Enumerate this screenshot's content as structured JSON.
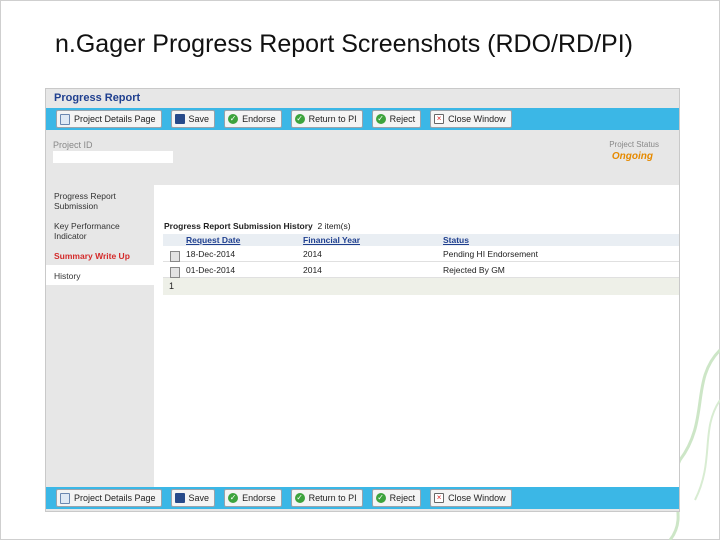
{
  "slide": {
    "title": "n.Gager Progress Report Screenshots (RDO/RD/PI)"
  },
  "app": {
    "header_title": "Progress Report"
  },
  "toolbar": [
    {
      "label": "Project Details Page",
      "icon": "page-icon"
    },
    {
      "label": "Save",
      "icon": "disk-icon"
    },
    {
      "label": "Endorse",
      "icon": "check-icon"
    },
    {
      "label": "Return to PI",
      "icon": "check-icon"
    },
    {
      "label": "Reject",
      "icon": "check-icon"
    },
    {
      "label": "Close Window",
      "icon": "close-icon"
    }
  ],
  "project": {
    "id_label": "Project ID",
    "id_value": "",
    "status_label": "Project Status",
    "status_value": "Ongoing"
  },
  "sidebar": {
    "items": [
      {
        "label": "Progress Report Submission"
      },
      {
        "label": "Key Performance Indicator"
      },
      {
        "label": "Summary Write Up"
      },
      {
        "label": "History"
      }
    ]
  },
  "history": {
    "title": "Progress Report Submission History",
    "count": "2 item(s)",
    "headers": [
      "Request Date",
      "Financial Year",
      "Status"
    ],
    "rows": [
      [
        "18-Dec-2014",
        "2014",
        "Pending HI Endorsement"
      ],
      [
        "01-Dec-2014",
        "2014",
        "Rejected By GM"
      ]
    ],
    "page": "1"
  },
  "colors": {
    "accent": "#3bb7e6",
    "status": "#e68a00",
    "link": "#1f3f8f"
  }
}
